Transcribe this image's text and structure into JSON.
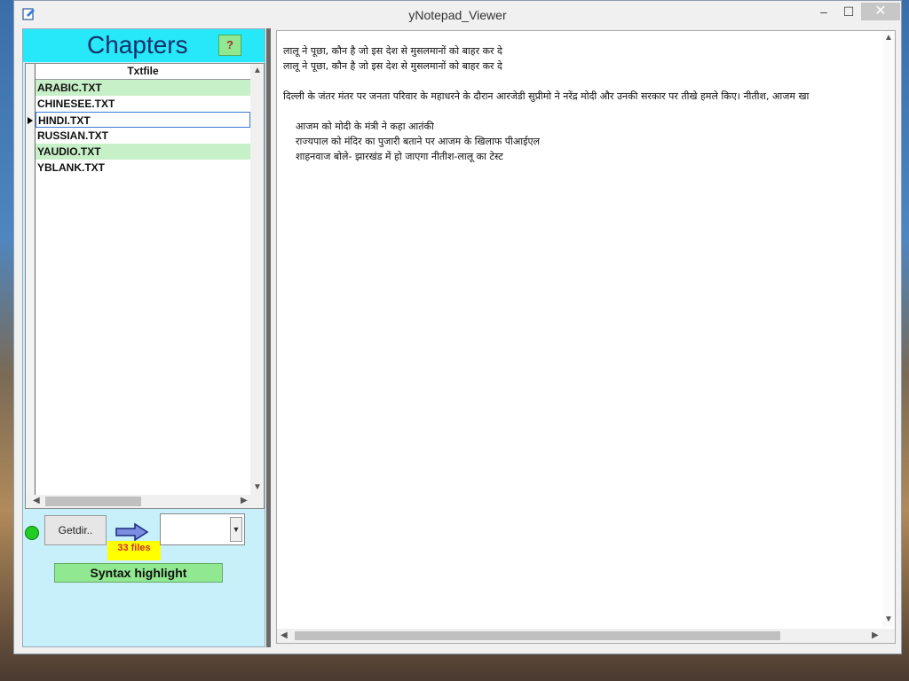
{
  "window": {
    "title": "yNotepad_Viewer",
    "min_label": "–",
    "max_label": "☐",
    "close_label": "✕"
  },
  "left": {
    "heading": "Chapters",
    "help_label": "?",
    "column_header": "Txtfile",
    "files": [
      {
        "name": "ARABIC.TXT",
        "highlight": true
      },
      {
        "name": "CHINESEE.TXT",
        "highlight": false
      },
      {
        "name": "HINDI.TXT",
        "selected": true
      },
      {
        "name": "RUSSIAN.TXT",
        "highlight": false
      },
      {
        "name": "YAUDIO.TXT",
        "highlight": true
      },
      {
        "name": "YBLANK.TXT",
        "highlight": false
      }
    ],
    "getdir_label": "Getdir..",
    "file_count": "33 files",
    "combo_value": "",
    "syntax_label": "Syntax highlight"
  },
  "content": {
    "lines": [
      "लालू ने पूछा, कौन है जो इस देश से मुसलमानों को बाहर कर दे",
      "लालू ने पूछा, कौन है जो इस देश से मुसलमानों को बाहर कर दे",
      "",
      "दिल्ली के जंतर मंतर पर जनता परिवार के महाधरने के दौरान आरजेडी सुप्रीमो ने नरेंद्र मोदी और उनकी सरकार पर तीखे हमले किए। नीतीश, आजम खा",
      "",
      "    आजम को मोदी के मंत्री ने कहा आतंकी",
      "    राज्यपाल को मंदिर का पुजारी बताने पर आजम के खिलाफ पीआईएल",
      "    शाहनवाज बोले- झारखंड में हो जाएगा नीतीश-लालू का टेस्ट"
    ]
  },
  "colors": {
    "chapters_bg": "#26e8f8",
    "panel_bg": "#c8f0fb",
    "row_highlight": "#c8f0c8",
    "button_green": "#90e890",
    "badge_yellow": "#ffff00"
  }
}
